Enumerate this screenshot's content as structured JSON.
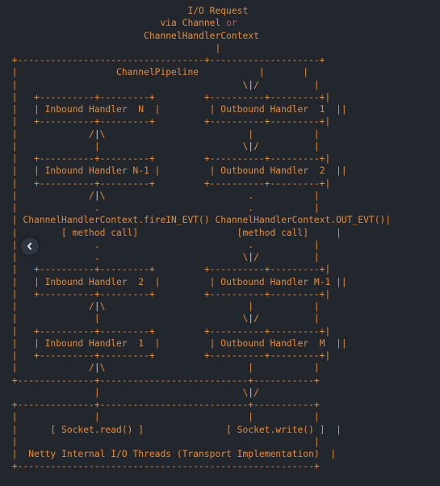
{
  "header": {
    "l1": "I/O Request",
    "l2a": "via Channel ",
    "l2_or": "or",
    "l3": "ChannelHandlerContext"
  },
  "title": "ChannelPipeline",
  "in_n": "Inbound Handler  N",
  "in_n1": "Inbound Handler N-1",
  "in_2": "Inbound Handler  2",
  "in_1": "Inbound Handler  1",
  "out_1": "Outbound Handler  1",
  "out_2": "Outbound Handler  2",
  "out_m1": "Outbound Handler M-1",
  "out_m": "Outbound Handler  M",
  "ctx_in": "ChannelHandlerContext.fireIN_EVT()",
  "ctx_out": "ChannelHandlerContext.OUT_EVT()",
  "mc_in": "[ method call]",
  "mc_out": "[method call]",
  "sread": "[ Socket.read() ]",
  "swrite": "[ Socket.write() ]",
  "footer": "Netty Internal I/O Threads (Transport Implementation)",
  "nav": "previous"
}
